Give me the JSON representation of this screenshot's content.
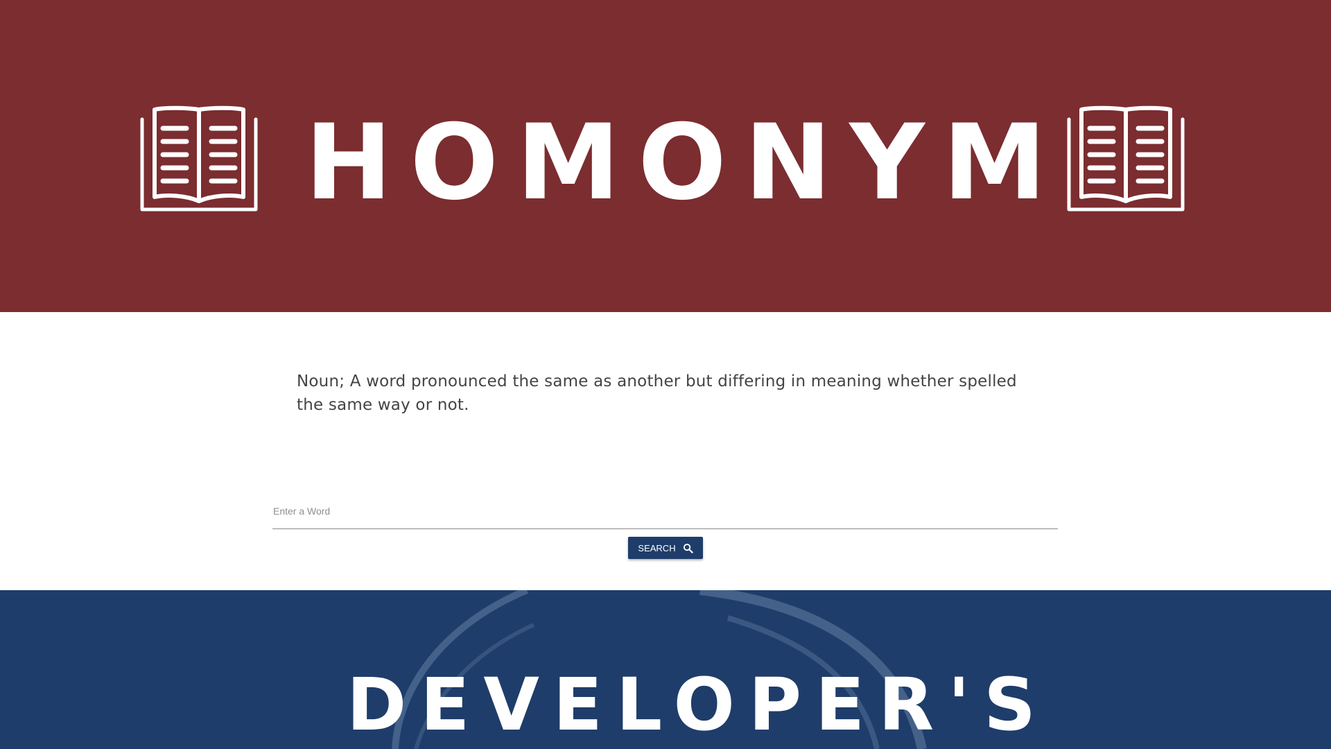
{
  "colors": {
    "header_background": "#7b2d30",
    "footer_background": "#1f3d6a",
    "button_background": "#1f3d6a"
  },
  "header": {
    "title": "HOMONYM",
    "left_icon": "open-book-icon",
    "right_icon": "open-book-icon"
  },
  "definition": {
    "text": "Noun; A word pronounced the same as another but differing in meaning whether spelled the same way or not."
  },
  "search": {
    "placeholder": "Enter a Word",
    "value": "",
    "button_label": "SEARCH",
    "button_icon": "search-icon"
  },
  "footer": {
    "title": "DEVELOPER'S"
  }
}
